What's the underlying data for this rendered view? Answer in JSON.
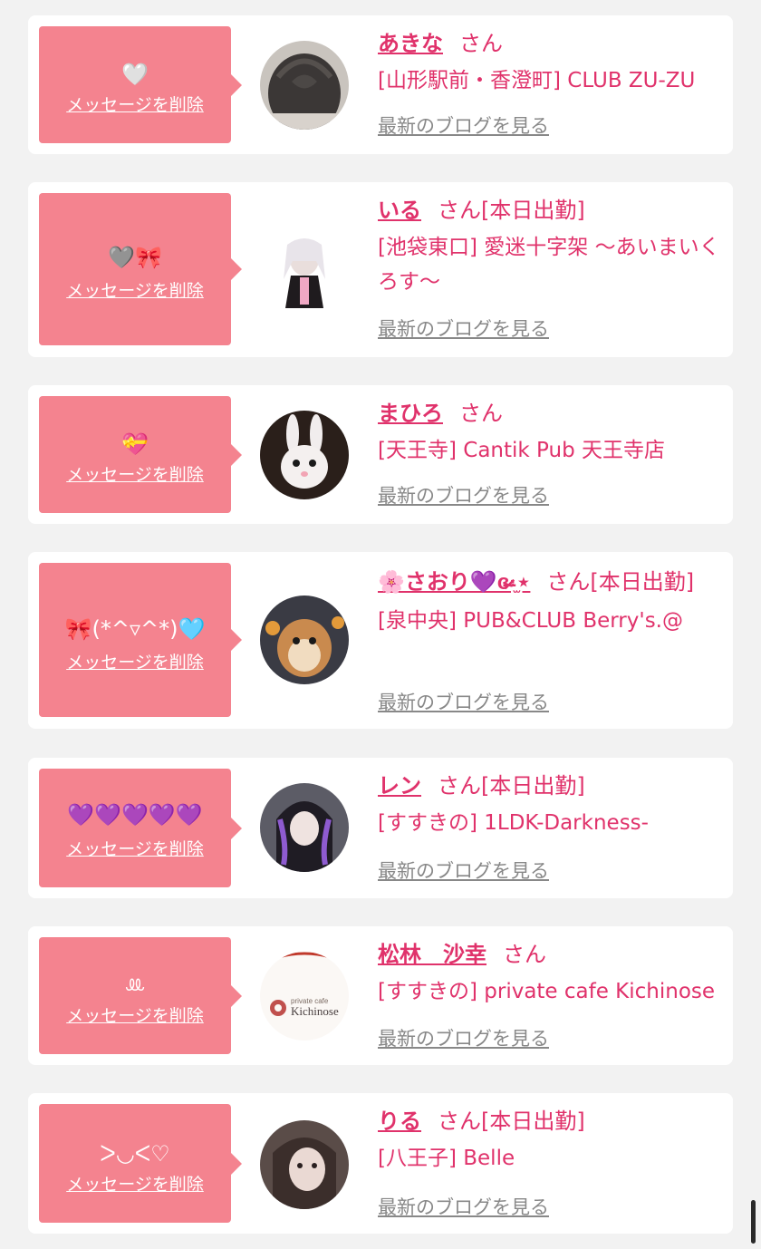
{
  "labels": {
    "delete_message": "メッセージを削除",
    "san": "さん",
    "latest_blog": "最新のブログを見る"
  },
  "colors": {
    "background": "#f2f2f2",
    "card": "#ffffff",
    "accent_pink": "#f4838f",
    "name_text": "#e0326b",
    "blog_link": "#888888"
  },
  "favorites": [
    {
      "message": "🤍",
      "name": "あきな",
      "today": "",
      "shop": "[山形駅前・香澄町] CLUB ZU-ZU",
      "avatar": "hair-photo"
    },
    {
      "message": "🩶🎀",
      "name": "いる",
      "today": "[本日出勤]",
      "shop": "[池袋東口] 愛迷十字架 〜あいまいくろす〜",
      "avatar": "girl-photo"
    },
    {
      "message": "💝",
      "name": "まひろ",
      "today": "",
      "shop": "[天王寺] Cantik Pub 天王寺店",
      "avatar": "bunny-photo"
    },
    {
      "message": "🎀(*^▿^*)🩵",
      "name": "🌸さおり💜ɞ̴̶̷·̫⋆",
      "today": "[本日出勤]",
      "shop": "[泉中央] PUB&CLUB Berry's.@",
      "avatar": "hamster-photo"
    },
    {
      "message": "💜💜💜💜💜",
      "name": "レン",
      "today": "[本日出勤]",
      "shop": "[すすきの] 1LDK-Darkness-",
      "avatar": "girl-dark-photo"
    },
    {
      "message": "ꔛ",
      "name": "松林　沙幸",
      "today": "",
      "shop": "[すすきの] private cafe Kichinose",
      "avatar": "kichinose-logo"
    },
    {
      "message": "ᐳ◡ᐸ♡",
      "name": "りる",
      "today": "[本日出勤]",
      "shop": "[八王子] Belle",
      "avatar": "girl-selfie-photo"
    }
  ],
  "kichinose_logo": {
    "small": "private cafe",
    "big": "Kichinose"
  }
}
